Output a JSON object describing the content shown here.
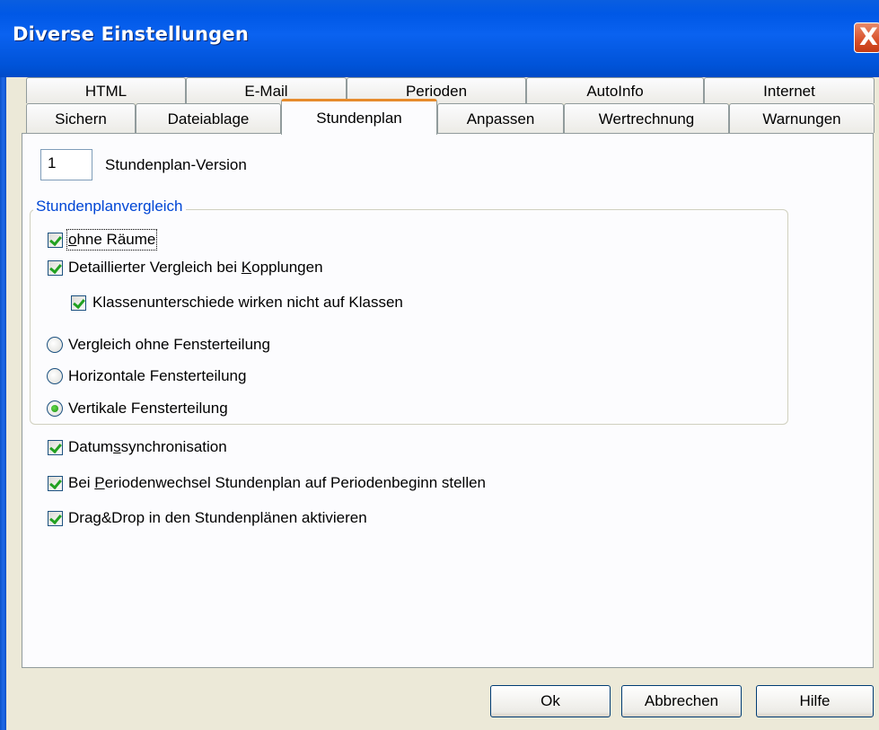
{
  "window": {
    "title": "Diverse Einstellungen",
    "close_glyph": "X"
  },
  "tabs": {
    "row1": [
      "HTML",
      "E-Mail",
      "Perioden",
      "AutoInfo",
      "Internet"
    ],
    "row2": [
      "Sichern",
      "Dateiablage",
      "Stundenplan",
      "Anpassen",
      "Wertrechnung",
      "Warnungen"
    ],
    "active": "Stundenplan"
  },
  "version": {
    "value": "1",
    "label": "Stundenplan-Version"
  },
  "comparison": {
    "legend": "Stundenplanvergleich",
    "ohne_raeume": {
      "pre": "",
      "key": "o",
      "post": "hne Räume",
      "checked": true
    },
    "detail": {
      "pre": "Detaillierter Vergleich bei ",
      "key": "K",
      "post": "opplungen",
      "checked": true
    },
    "klassen": {
      "label": "Klassenunterschiede wirken nicht auf Klassen",
      "checked": true
    },
    "radios": [
      {
        "label": "Vergleich ohne Fensterteilung",
        "checked": false
      },
      {
        "label": "Horizontale Fensterteilung",
        "checked": false
      },
      {
        "label": "Vertikale Fensterteilung",
        "checked": true
      }
    ]
  },
  "options": {
    "datum": {
      "pre": "Datum",
      "key": "s",
      "post": "synchronisation",
      "checked": true
    },
    "periode": {
      "pre": "Bei ",
      "key": "P",
      "post": "eriodenwechsel Stundenplan auf Periodenbeginn stellen",
      "checked": true
    },
    "dragdrop": {
      "label": "Drag&Drop in den Stundenplänen aktivieren",
      "checked": true
    }
  },
  "buttons": {
    "ok": "Ok",
    "cancel": "Abbrechen",
    "help": "Hilfe"
  },
  "colors": {
    "titlebar": "#0058e6",
    "active_tab_accent": "#e68b2c",
    "legend_text": "#0046d5",
    "check": "#21a121"
  }
}
